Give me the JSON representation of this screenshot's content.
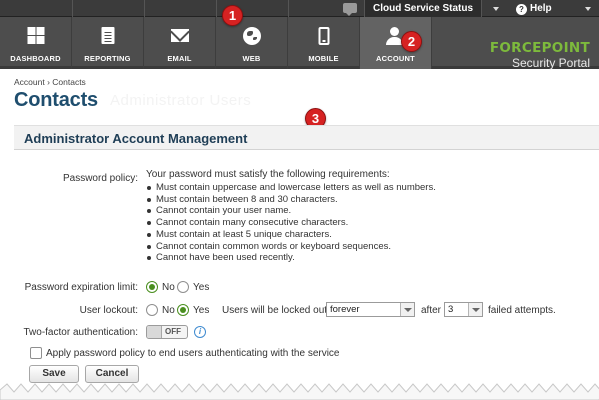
{
  "topbar": {
    "cloud_status": "Cloud Service Status",
    "help": "Help",
    "chat_icon": "chat-bubble-icon"
  },
  "nav": {
    "items": [
      {
        "label": "DASHBOARD",
        "icon": "dashboard-icon"
      },
      {
        "label": "REPORTING",
        "icon": "report-icon"
      },
      {
        "label": "EMAIL",
        "icon": "envelope-icon"
      },
      {
        "label": "WEB",
        "icon": "globe-icon"
      },
      {
        "label": "MOBILE",
        "icon": "mobile-icon"
      },
      {
        "label": "ACCOUNT",
        "icon": "user-icon",
        "active": true
      }
    ],
    "brand_name": "FORCEPOINT",
    "brand_sub": "Security Portal"
  },
  "callouts": [
    "1",
    "2",
    "3"
  ],
  "page": {
    "breadcrumb": "Account › Contacts",
    "title": "Contacts",
    "ghost_text": "Administrator Users"
  },
  "section": {
    "title": "Administrator Account Management"
  },
  "password_policy": {
    "label": "Password policy:",
    "intro": "Your password must satisfy the following requirements:",
    "rules": [
      "Must contain uppercase and lowercase letters as well as numbers.",
      "Must contain between 8 and 30 characters.",
      "Cannot contain your user name.",
      "Cannot contain many consecutive characters.",
      "Must contain at least 5 unique characters.",
      "Cannot contain common words or keyboard sequences.",
      "Cannot have been used recently."
    ]
  },
  "expiration": {
    "label": "Password expiration limit:",
    "no": "No",
    "yes": "Yes",
    "selected": "No"
  },
  "lockout": {
    "label": "User lockout:",
    "no": "No",
    "yes": "Yes",
    "selected": "Yes",
    "prefix": "Users will be locked out",
    "duration": "forever",
    "after": "after",
    "attempts": "3",
    "suffix": "failed attempts."
  },
  "two_factor": {
    "label": "Two-factor authentication:",
    "state": "OFF"
  },
  "apply_end_users": {
    "label": "Apply password policy to end users authenticating with the service",
    "checked": false
  },
  "buttons": {
    "save": "Save",
    "cancel": "Cancel"
  },
  "colors": {
    "nav_bg": "#4d4d4d",
    "brand_green": "#7dba3c",
    "title_blue": "#1f4e6e",
    "callout_red": "#d62222",
    "radio_green": "#4a8f1f"
  }
}
